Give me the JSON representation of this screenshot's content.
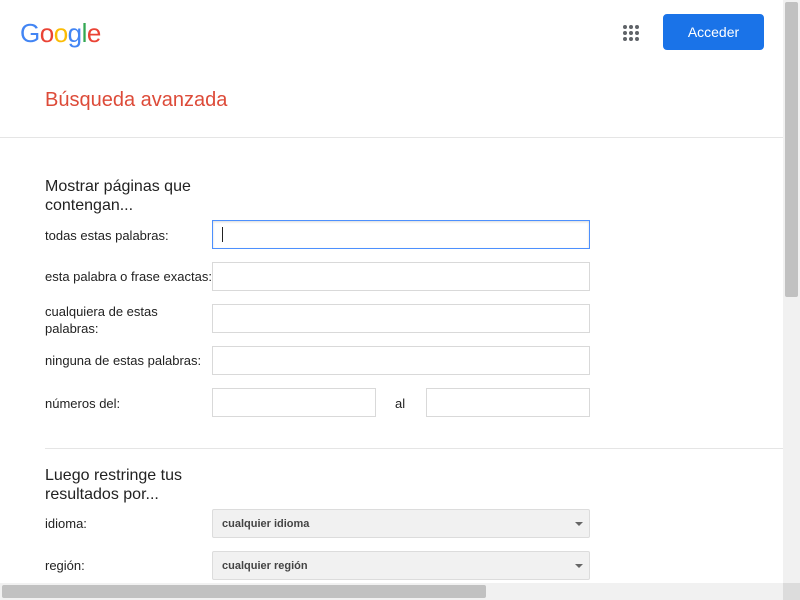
{
  "header": {
    "logo_letters": [
      {
        "char": "G",
        "color": "#4285F4"
      },
      {
        "char": "o",
        "color": "#EA4335"
      },
      {
        "char": "o",
        "color": "#FBBC05"
      },
      {
        "char": "g",
        "color": "#4285F4"
      },
      {
        "char": "l",
        "color": "#34A853"
      },
      {
        "char": "e",
        "color": "#EA4335"
      }
    ],
    "apps_icon": "apps-grid-icon",
    "signin_label": "Acceder",
    "signin_color": "#1a73e8"
  },
  "page": {
    "title": "Búsqueda avanzada",
    "title_color": "#dd4b39"
  },
  "section1": {
    "heading": "Mostrar páginas que contengan...",
    "all_words_label": "todas estas palabras:",
    "exact_phrase_label": "esta palabra o frase exactas:",
    "any_words_label": "cualquiera de estas palabras:",
    "none_words_label": "ninguna de estas palabras:",
    "numbers_label": "números del:",
    "numbers_to_label": "al"
  },
  "section2": {
    "heading": "Luego restringe tus resultados por...",
    "language_label": "idioma:",
    "language_value": "cualquier idioma",
    "region_label": "región:",
    "region_value": "cualquier región"
  }
}
